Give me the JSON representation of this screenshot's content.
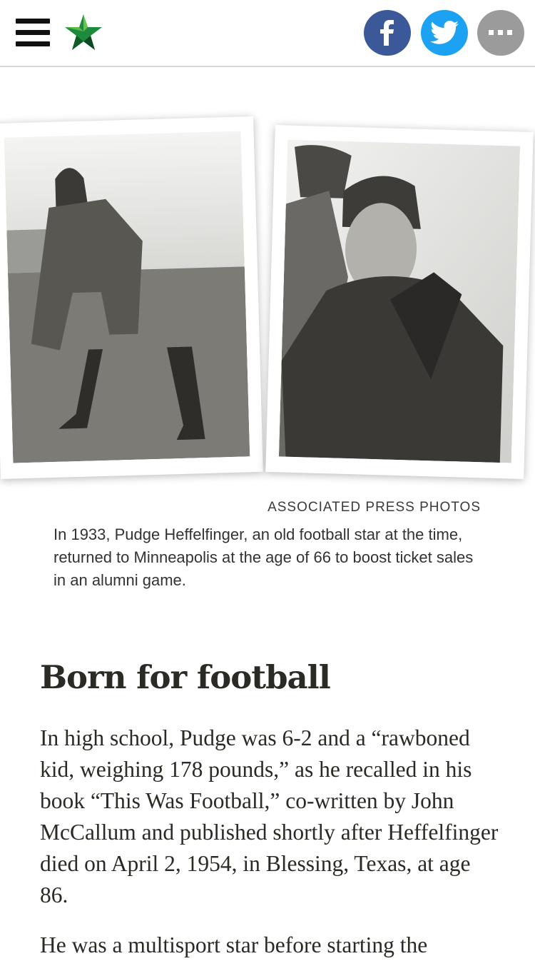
{
  "header": {
    "menu_icon": "hamburger-menu-icon",
    "logo_icon": "star-logo-icon",
    "brand_color": "#1d8a3a",
    "share": [
      {
        "name": "facebook",
        "icon": "facebook-icon",
        "color": "#3b5998"
      },
      {
        "name": "twitter",
        "icon": "twitter-icon",
        "color": "#1da1f2"
      },
      {
        "name": "more",
        "icon": "more-icon",
        "label": "···",
        "color": "#9b9b9b"
      }
    ]
  },
  "figure": {
    "photos": [
      {
        "name": "photo-player-crouching"
      },
      {
        "name": "photo-player-in-coat"
      }
    ],
    "credit": "ASSOCIATED PRESS PHOTOS",
    "caption": "In 1933, Pudge Heffelfinger, an old football star at the time, returned to Minneapolis at the age of 66 to boost ticket sales in an alumni game."
  },
  "article": {
    "heading": "Born for football",
    "paragraphs": [
      "In high school, Pudge was 6-2 and a “rawboned kid, weighing 178 pounds,” as he recalled in his book “This Was Football,” co-written by John McCallum and published shortly after Heffelfinger died on April 2, 1954, in Blessing, Texas, at age 86.",
      "He was a multisport star before starting the"
    ]
  }
}
